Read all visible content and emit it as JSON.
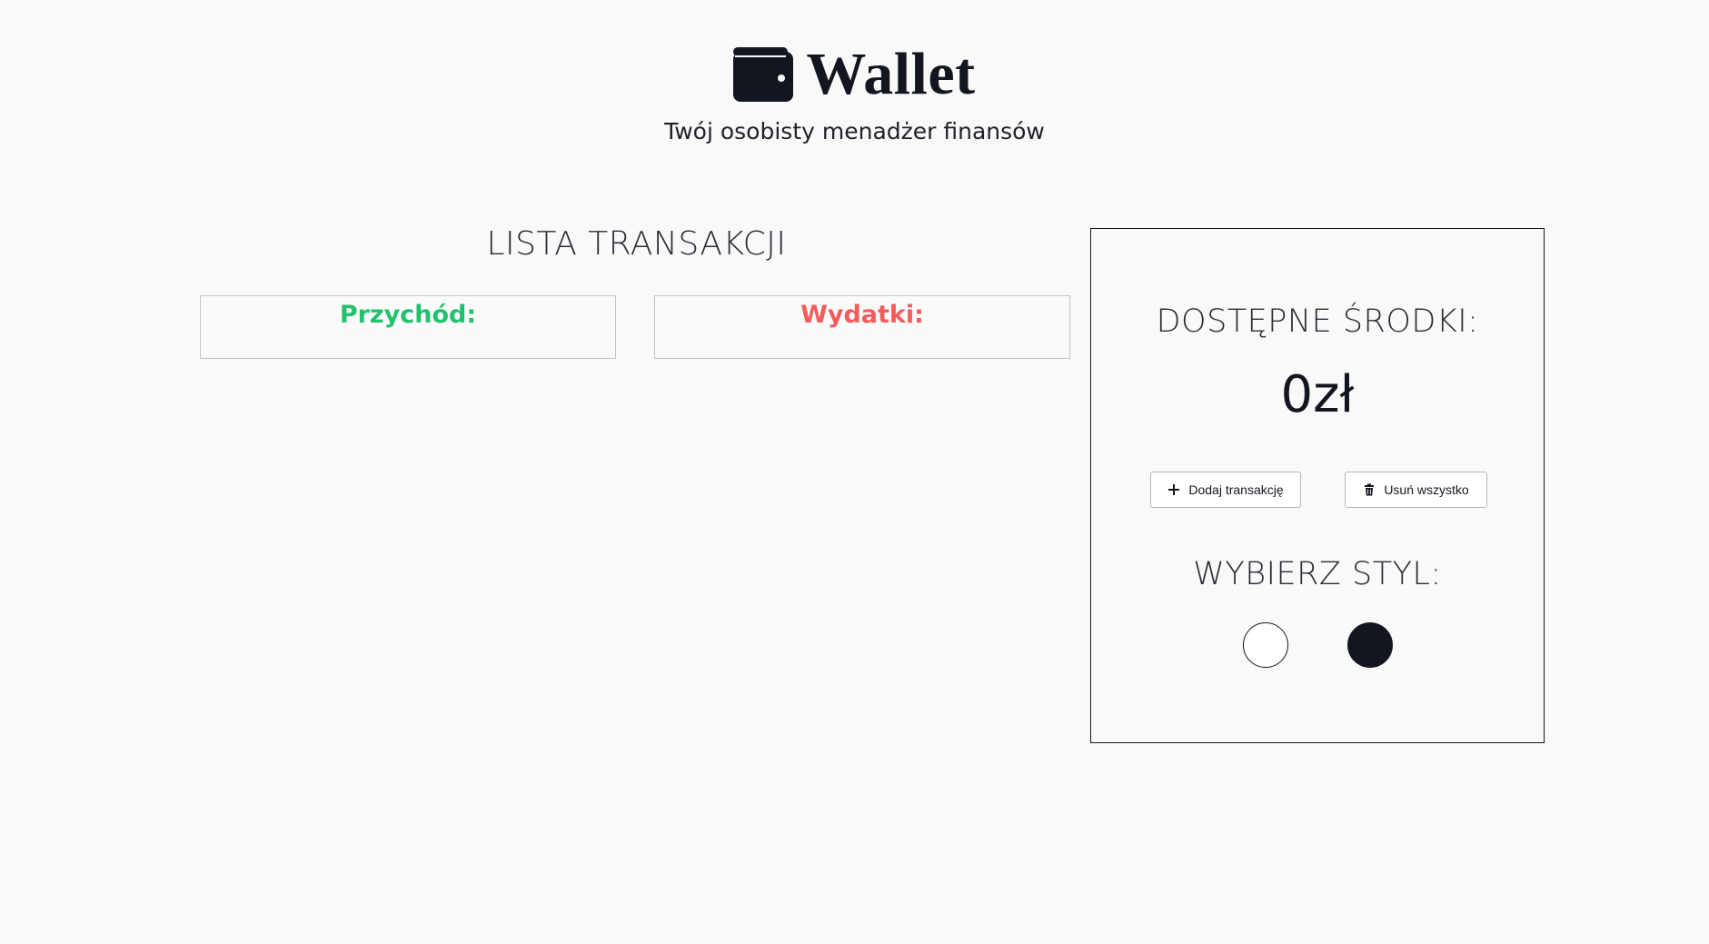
{
  "header": {
    "title": "Wallet",
    "subtitle": "Twój osobisty menadżer finansów",
    "icon": "wallet-icon"
  },
  "transactions": {
    "title": "LISTA TRANSAKCJI",
    "income_label": "Przychód:",
    "expense_label": "Wydatki:",
    "income_color": "#22c26d",
    "expense_color": "#f25c5c"
  },
  "panel": {
    "available_title": "DOSTĘPNE ŚRODKI:",
    "balance": "0zł",
    "add_button": {
      "label": "Dodaj transakcję",
      "icon": "plus-icon"
    },
    "delete_button": {
      "label": "Usuń wszystko",
      "icon": "trash-icon"
    },
    "style_title": "WYBIERZ STYL:",
    "styles": [
      {
        "name": "light",
        "color": "#ffffff"
      },
      {
        "name": "dark",
        "color": "#14161f"
      }
    ]
  }
}
